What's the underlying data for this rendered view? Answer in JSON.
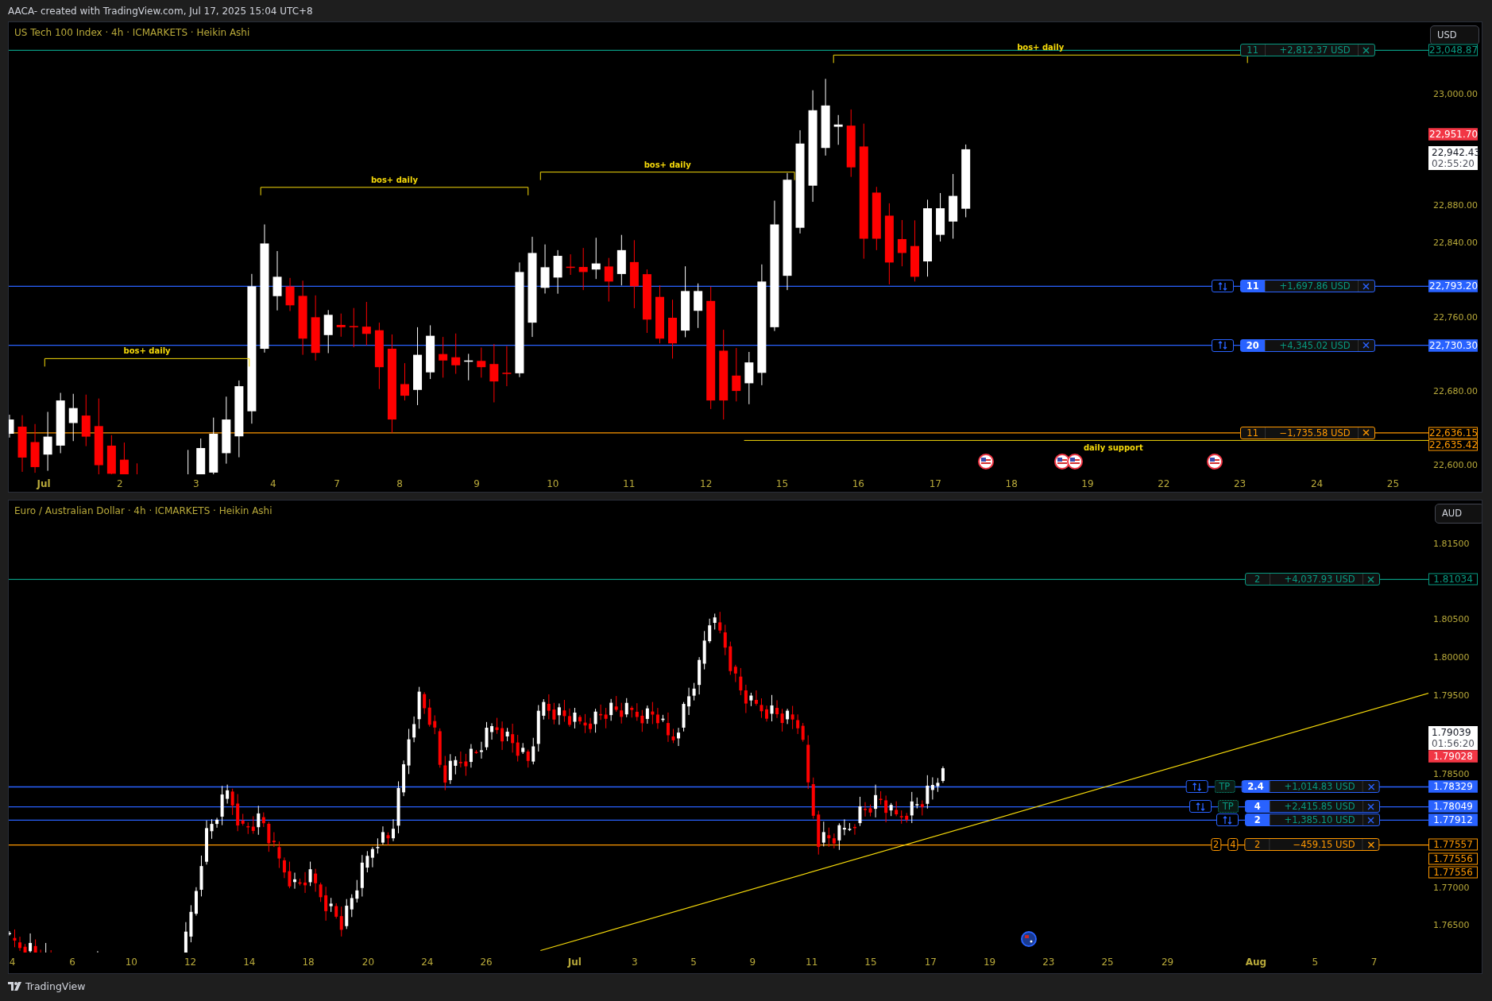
{
  "header": {
    "title": "AACA- created with TradingView.com, Jul 17, 2025 15:04 UTC+8"
  },
  "panes": [
    {
      "legend": "US Tech 100 Index · 4h · ICMARKETS · Heikin Ashi",
      "currency": "USD",
      "price_ticks": [
        "23,000.00",
        "22,880.00",
        "22,840.00",
        "22,760.00",
        "22,680.00",
        "22,600.00"
      ],
      "positions": [
        {
          "kind": "target",
          "qty": "11",
          "pnl": "+2,812.37 USD",
          "price": "23,048.87",
          "reverse": false
        },
        {
          "kind": "entry",
          "qty": "11",
          "pnl": "+1,697.86 USD",
          "price": "22,793.20",
          "reverse": true
        },
        {
          "kind": "entry",
          "qty": "20",
          "pnl": "+4,345.02 USD",
          "price": "22,730.30",
          "reverse": true
        },
        {
          "kind": "stop",
          "qty": "11",
          "pnl": "−1,735.58 USD",
          "price": "22,636.15",
          "reverse": false
        }
      ],
      "drawings": [
        {
          "kind": "bos",
          "label": "bos+ daily"
        },
        {
          "kind": "bos",
          "label": "bos+ daily"
        },
        {
          "kind": "bos",
          "label": "bos+ daily"
        },
        {
          "kind": "bos",
          "label": "bos+ daily"
        },
        {
          "kind": "support",
          "label": "daily support",
          "price": "22,635.42"
        }
      ],
      "countdown": {
        "price": "22,942.43",
        "time": "02:55:20"
      },
      "last_price": "22,951.70",
      "date_ticks": [
        {
          "label": "Jul",
          "kind": "month"
        },
        {
          "label": "2",
          "kind": "day"
        },
        {
          "label": "3",
          "kind": "day"
        },
        {
          "label": "4",
          "kind": "day"
        },
        {
          "label": "7",
          "kind": "day"
        },
        {
          "label": "8",
          "kind": "day"
        },
        {
          "label": "9",
          "kind": "day"
        },
        {
          "label": "10",
          "kind": "day"
        },
        {
          "label": "11",
          "kind": "day"
        },
        {
          "label": "12",
          "kind": "day"
        },
        {
          "label": "15",
          "kind": "day"
        },
        {
          "label": "16",
          "kind": "day"
        },
        {
          "label": "17",
          "kind": "day"
        },
        {
          "label": "18",
          "kind": "day"
        },
        {
          "label": "19",
          "kind": "day"
        },
        {
          "label": "22",
          "kind": "day"
        },
        {
          "label": "23",
          "kind": "day"
        },
        {
          "label": "24",
          "kind": "day"
        },
        {
          "label": "25",
          "kind": "day"
        }
      ]
    },
    {
      "legend": "Euro / Australian Dollar · 4h · ICMARKETS · Heikin Ashi",
      "currency": "AUD",
      "price_ticks": [
        "1.81500",
        "1.80500",
        "1.80000",
        "1.79500",
        "1.78500",
        "1.77000",
        "1.76500"
      ],
      "positions": [
        {
          "kind": "target",
          "qty": "2",
          "pnl": "+4,037.93 USD",
          "price": "1.81034",
          "reverse": false
        },
        {
          "kind": "entry",
          "qty": "2.4",
          "pnl": "+1,014.83 USD",
          "price": "1.78329",
          "reverse": true,
          "tp": "TP"
        },
        {
          "kind": "entry",
          "qty": "4",
          "pnl": "+2,415.85 USD",
          "price": "1.78049",
          "reverse": true,
          "tp": "TP"
        },
        {
          "kind": "entry",
          "qty": "2",
          "pnl": "+1,385.10 USD",
          "price": "1.77912",
          "reverse": true
        },
        {
          "kind": "stop",
          "qty": "2",
          "pnl": "−459.15 USD",
          "price": "1.77557",
          "reverse": false,
          "stacked": [
            "2",
            "4"
          ]
        }
      ],
      "extra_price_labels": [
        {
          "kind": "stop",
          "price": "1.77556"
        },
        {
          "kind": "stop",
          "price": "1.77556"
        }
      ],
      "drawings": [
        {
          "kind": "trendline"
        }
      ],
      "countdown": {
        "price": "1.79039",
        "time": "01:56:20"
      },
      "last_price": "1.79028",
      "date_ticks": [
        {
          "label": "4",
          "kind": "day"
        },
        {
          "label": "6",
          "kind": "day"
        },
        {
          "label": "10",
          "kind": "day"
        },
        {
          "label": "12",
          "kind": "day"
        },
        {
          "label": "14",
          "kind": "day"
        },
        {
          "label": "18",
          "kind": "day"
        },
        {
          "label": "20",
          "kind": "day"
        },
        {
          "label": "24",
          "kind": "day"
        },
        {
          "label": "26",
          "kind": "day"
        },
        {
          "label": "Jul",
          "kind": "month"
        },
        {
          "label": "3",
          "kind": "day"
        },
        {
          "label": "5",
          "kind": "day"
        },
        {
          "label": "9",
          "kind": "day"
        },
        {
          "label": "11",
          "kind": "day"
        },
        {
          "label": "15",
          "kind": "day"
        },
        {
          "label": "17",
          "kind": "day"
        },
        {
          "label": "19",
          "kind": "day"
        },
        {
          "label": "23",
          "kind": "day"
        },
        {
          "label": "25",
          "kind": "day"
        },
        {
          "label": "29",
          "kind": "day"
        },
        {
          "label": "Aug",
          "kind": "month"
        },
        {
          "label": "5",
          "kind": "day"
        },
        {
          "label": "7",
          "kind": "day"
        }
      ]
    }
  ],
  "footer": {
    "brand": "TradingView"
  }
}
